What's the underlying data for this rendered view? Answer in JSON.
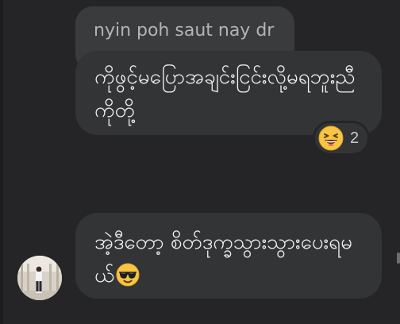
{
  "reply": {
    "quoted_text": "nyin poh saut nay dr"
  },
  "messages": [
    {
      "text": "ကိုဖွင့်မပြောအချင်းငြင်းလို့မရဘူးညီကိုတို့",
      "reaction": {
        "emoji": "laughing-face-icon",
        "count": "2"
      }
    },
    {
      "text": "အဲ့ဒီတော့ စိတ်ဒုက္ခသွားသွားပေးရမယ်",
      "trailing_emoji": "sunglasses-face-icon"
    }
  ],
  "sender": {
    "avatar": "avatar-photo"
  },
  "colors": {
    "background": "#252527",
    "bubble": "#333436",
    "reply_bubble": "#3a3b3d",
    "text": "#f1f1f2",
    "muted_text": "#b2b4b7"
  }
}
